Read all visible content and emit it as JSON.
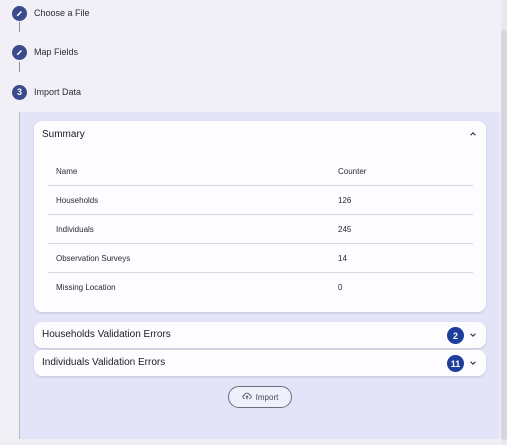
{
  "stepper": {
    "steps": [
      {
        "label": "Choose a File",
        "marker": "edit-icon"
      },
      {
        "label": "Map Fields",
        "marker": "edit-icon"
      },
      {
        "label": "Import Data",
        "number": "3"
      }
    ]
  },
  "summary": {
    "title": "Summary",
    "columns": [
      "Name",
      "Counter"
    ],
    "rows": [
      {
        "name": "Households",
        "counter": "126"
      },
      {
        "name": "Individuals",
        "counter": "245"
      },
      {
        "name": "Observation Surveys",
        "counter": "14"
      },
      {
        "name": "Missing Location",
        "counter": "0"
      }
    ]
  },
  "errors": [
    {
      "title": "Households Validation Errors",
      "count": "2"
    },
    {
      "title": "Individuals Validation Errors",
      "count": "11"
    }
  ],
  "actions": {
    "import_label": "Import"
  },
  "colors": {
    "accent": "#1f3e9c",
    "step": "#3a4a8c",
    "panel": "#e4e4f8"
  }
}
